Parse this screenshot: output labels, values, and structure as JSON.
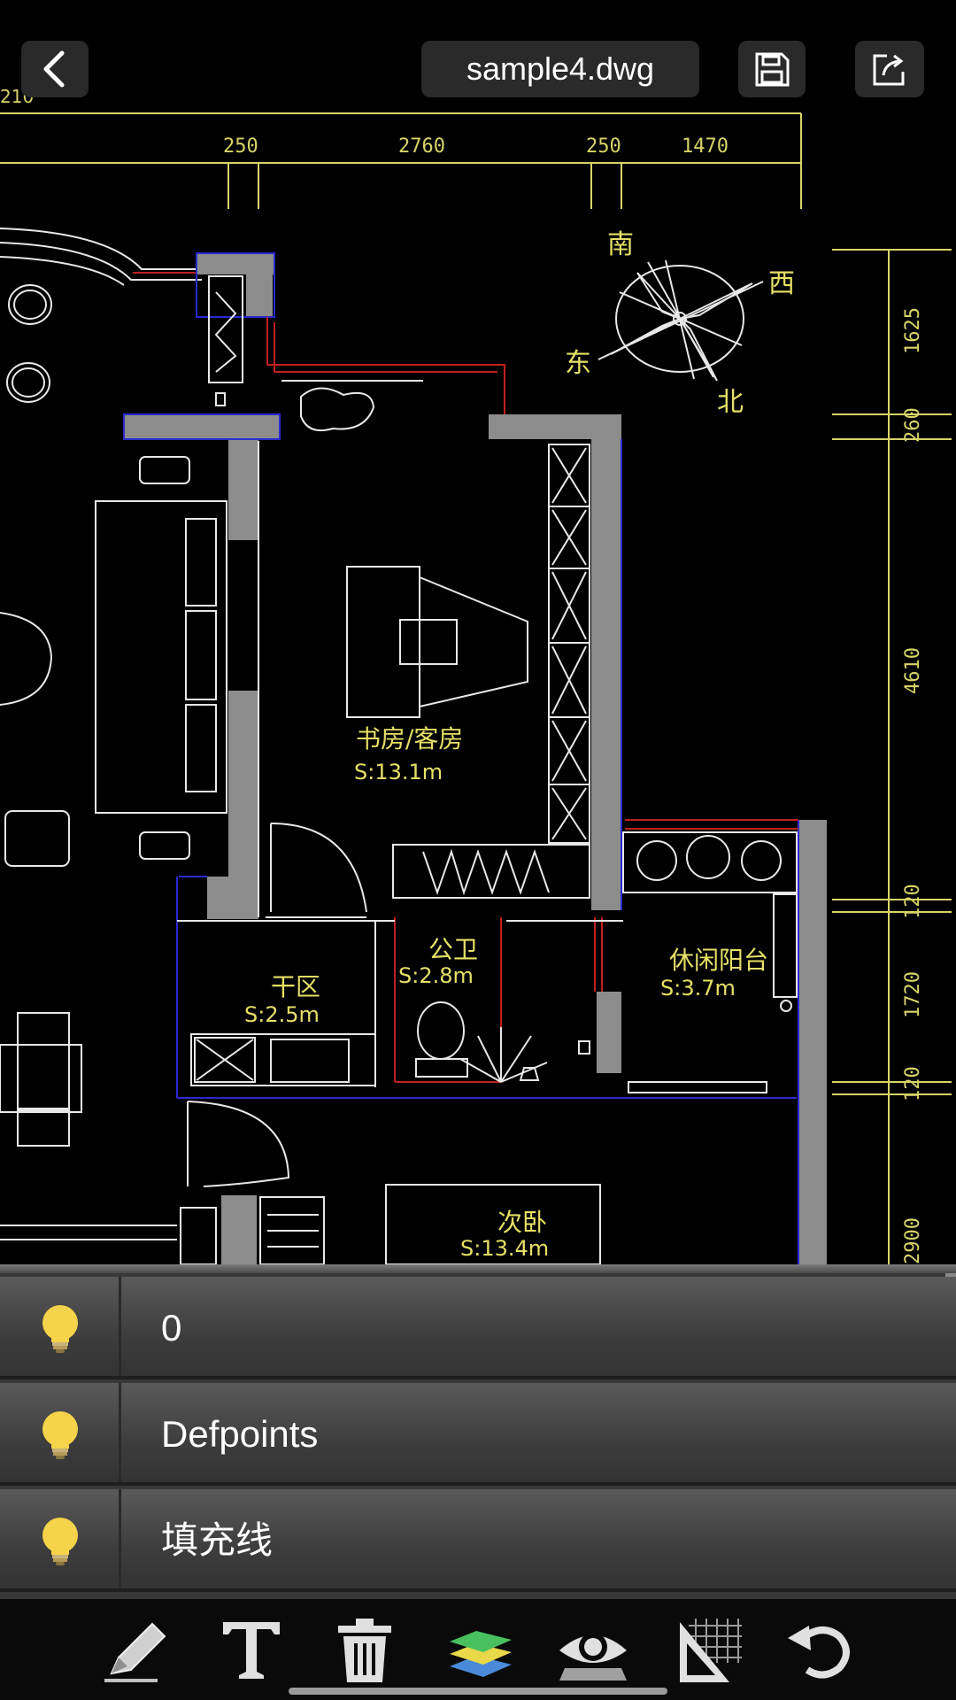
{
  "header": {
    "file_name": "sample4.dwg",
    "back_icon": "chevron-left-icon",
    "save_icon": "save-icon",
    "share_icon": "share-icon"
  },
  "drawing": {
    "dim_top": [
      "250",
      "2760",
      "250",
      "1470"
    ],
    "dim_top_left": "210",
    "dim_right": [
      "1625",
      "260",
      "4610",
      "120",
      "1720",
      "120",
      "2900"
    ],
    "compass": {
      "south": "南",
      "west": "西",
      "east": "东",
      "north": "北"
    },
    "rooms": [
      {
        "name": "书房/客房",
        "area": "S:13.1m"
      },
      {
        "name": "公卫",
        "area": "S:2.8m"
      },
      {
        "name": "休闲阳台",
        "area": "S:3.7m"
      },
      {
        "name": "干区",
        "area": "S:2.5m"
      },
      {
        "name": "次卧",
        "area": "S:13.4m"
      }
    ],
    "colors": {
      "wall": "#8c8c8c",
      "line": "#e8e8e8",
      "dim": "#d8d468",
      "label": "#e6e066",
      "accent_red": "#c02020",
      "accent_blue": "#2a2ad0"
    }
  },
  "layers": [
    {
      "name": "0",
      "icon": "lightbulb-icon"
    },
    {
      "name": "Defpoints",
      "icon": "lightbulb-icon"
    },
    {
      "name": "填充线",
      "icon": "lightbulb-icon"
    }
  ],
  "toolbar": {
    "tools": [
      "pencil-icon",
      "text-icon",
      "trash-icon",
      "layers-icon",
      "eye-icon",
      "grid-ruler-icon",
      "undo-icon"
    ]
  }
}
